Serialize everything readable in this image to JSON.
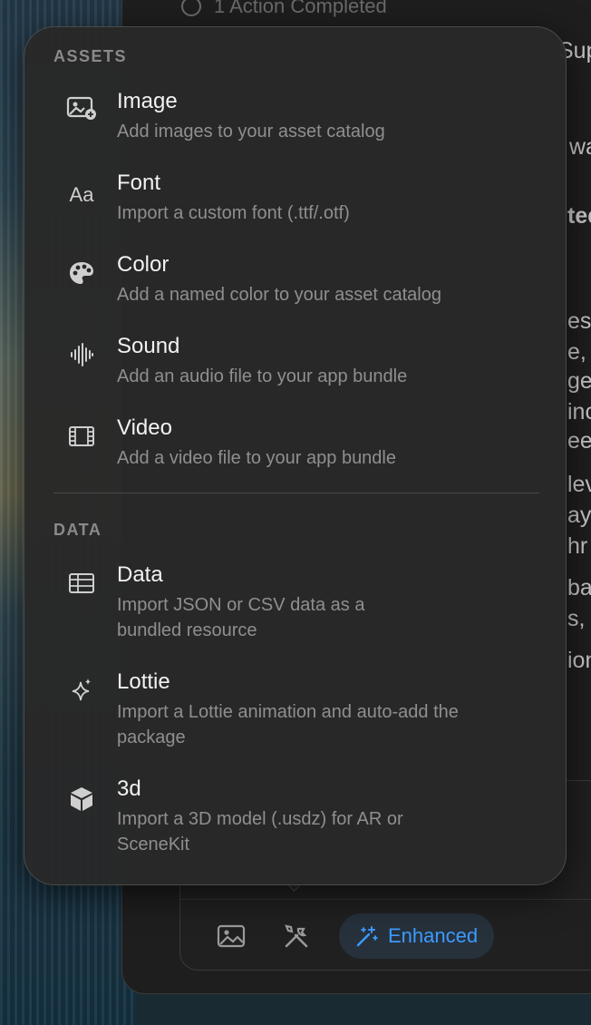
{
  "background": {
    "status_text": "1 Action Completed",
    "fragments": [
      "Sup",
      "wa",
      "ted",
      "es",
      "e,",
      "ge",
      "inc",
      "ee",
      "lev",
      "ay",
      "hr",
      "ba",
      "s, a",
      "ion"
    ]
  },
  "popover": {
    "sections": [
      {
        "title": "ASSETS",
        "items": [
          {
            "icon": "image-add-icon",
            "title": "Image",
            "desc": "Add images to your asset catalog"
          },
          {
            "icon": "font-icon",
            "icon_text": "Aa",
            "title": "Font",
            "desc": "Import a custom font (.ttf/.otf)"
          },
          {
            "icon": "palette-icon",
            "title": "Color",
            "desc": "Add a named color to your asset catalog"
          },
          {
            "icon": "waveform-icon",
            "title": "Sound",
            "desc": "Add an audio file to your app bundle"
          },
          {
            "icon": "film-icon",
            "title": "Video",
            "desc": "Add a video file to your app bundle"
          }
        ]
      },
      {
        "title": "DATA",
        "items": [
          {
            "icon": "table-icon",
            "title": "Data",
            "desc": "Import JSON or CSV data as a bundled resource"
          },
          {
            "icon": "sparkles-icon",
            "title": "Lottie",
            "desc": "Import a Lottie animation and auto-add the package"
          },
          {
            "icon": "cube-icon",
            "title": "3d",
            "desc": "Import a 3D model (.usdz) for AR or SceneKit"
          }
        ]
      }
    ]
  },
  "toolbar": {
    "enhanced_label": "Enhanced",
    "accent": "#3d9bff"
  }
}
